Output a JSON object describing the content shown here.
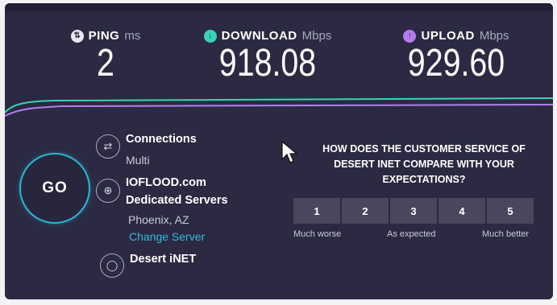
{
  "metrics": {
    "ping": {
      "label": "PING",
      "unit": "ms",
      "value": "2",
      "icon": "ping-arrows-icon",
      "color": "#e9e8f2"
    },
    "download": {
      "label": "DOWNLOAD",
      "unit": "Mbps",
      "value": "918.08",
      "icon": "download-arrow-icon",
      "color": "#3ad3b5"
    },
    "upload": {
      "label": "UPLOAD",
      "unit": "Mbps",
      "value": "929.60",
      "icon": "upload-arrow-icon",
      "color": "#b57cf0"
    }
  },
  "go_button": {
    "label": "GO"
  },
  "connections": {
    "title": "Connections",
    "value": "Multi",
    "icon": "connections-arrows-icon"
  },
  "server": {
    "name": "IOFLOOD.com",
    "type": "Dedicated Servers",
    "location": "Phoenix, AZ",
    "change_label": "Change Server",
    "icon": "globe-icon"
  },
  "isp": {
    "name": "Desert iNET",
    "icon": "user-icon"
  },
  "survey": {
    "question": "HOW DOES THE CUSTOMER SERVICE OF DESERT INET COMPARE WITH YOUR EXPECTATIONS?",
    "options": [
      "1",
      "2",
      "3",
      "4",
      "5"
    ],
    "low_label": "Much worse",
    "mid_label": "As expected",
    "high_label": "Much better"
  },
  "colors": {
    "background": "#2b2a42",
    "accent_cyan": "#2bb6d4",
    "download_line": "#3ad3b5",
    "upload_line": "#b57cf0",
    "link": "#33b8e0"
  }
}
